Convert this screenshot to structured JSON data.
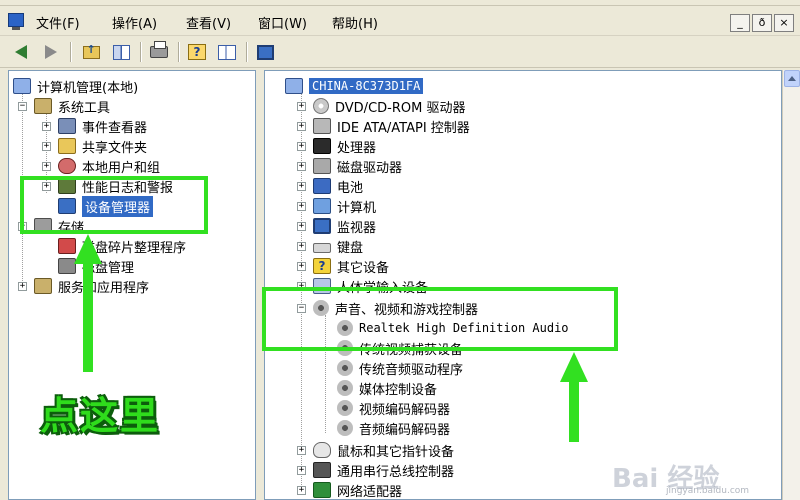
{
  "menubar": {
    "items": [
      "文件(F)",
      "操作(A)",
      "查看(V)",
      "窗口(W)",
      "帮助(H)"
    ],
    "window_buttons": [
      "_",
      "ð",
      "×"
    ]
  },
  "toolbar": {
    "icons": [
      "back-arrow-icon",
      "forward-arrow-icon",
      "up-folder-icon",
      "show-hide-tree-icon",
      "print-icon",
      "help-icon",
      "properties-icon",
      "scan-hardware-icon"
    ]
  },
  "left_tree": {
    "root": "计算机管理(本地)",
    "system_tools": "系统工具",
    "event_viewer": "事件查看器",
    "shared_folders": "共享文件夹",
    "local_users": "本地用户和组",
    "perf_logs": "性能日志和警报",
    "device_manager": "设备管理器",
    "storage": "存储",
    "defrag": "磁盘碎片整理程序",
    "disk_mgmt": "磁盘管理",
    "services": "服务和应用程序"
  },
  "right_tree": {
    "computer_name": "CHINA-8C373D1FA",
    "items": [
      "DVD/CD-ROM 驱动器",
      "IDE ATA/ATAPI 控制器",
      "处理器",
      "磁盘驱动器",
      "电池",
      "计算机",
      "监视器",
      "键盘",
      "其它设备",
      "人体学输入设备",
      "声音、视频和游戏控制器"
    ],
    "sound_children": [
      "Realtek High Definition Audio",
      "传统视频捕获设备",
      "传统音频驱动程序",
      "媒体控制设备",
      "视频编码解码器",
      "音频编码解码器"
    ],
    "after_items": [
      "鼠标和其它指针设备",
      "通用串行总线控制器",
      "网络适配器"
    ]
  },
  "annotation": {
    "click_here": "点这里",
    "highlight_color": "#32e021"
  },
  "watermark": {
    "brand": "Bai 经验",
    "sub": "jingyan.baidu.com"
  }
}
